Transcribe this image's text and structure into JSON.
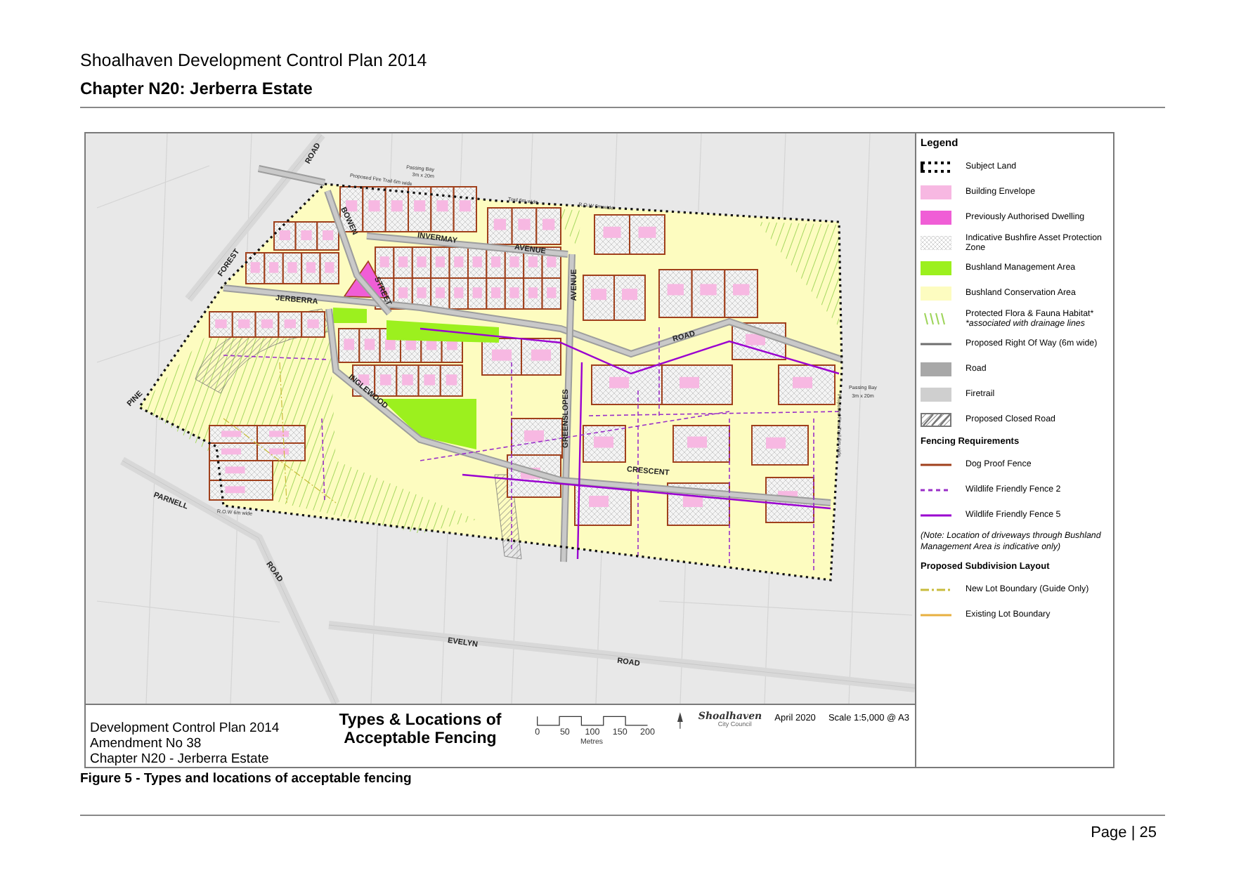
{
  "header": {
    "title": "Shoalhaven Development Control Plan 2014",
    "chapter": "Chapter N20: Jerberra Estate"
  },
  "map_labels": [
    {
      "text": "ROAD",
      "kind": "street"
    },
    {
      "text": "FOREST",
      "kind": "street"
    },
    {
      "text": "PINE",
      "kind": "street"
    },
    {
      "text": "BOWEN",
      "kind": "street"
    },
    {
      "text": "STREET",
      "kind": "street"
    },
    {
      "text": "INVERMAY",
      "kind": "street"
    },
    {
      "text": "AVENUE",
      "kind": "street"
    },
    {
      "text": "JERBERRA",
      "kind": "street"
    },
    {
      "text": "AVENUE",
      "kind": "street"
    },
    {
      "text": "ROAD",
      "kind": "street"
    },
    {
      "text": "GREENSLOPES",
      "kind": "street"
    },
    {
      "text": "INGLEWOOD",
      "kind": "street"
    },
    {
      "text": "CRESCENT",
      "kind": "street"
    },
    {
      "text": "PARNELL",
      "kind": "street"
    },
    {
      "text": "ROAD",
      "kind": "street"
    },
    {
      "text": "EVELYN",
      "kind": "street"
    },
    {
      "text": "ROAD",
      "kind": "street"
    },
    {
      "text": "Proposed Fire Trail 6m wide",
      "kind": "note"
    },
    {
      "text": "Passing Bay",
      "kind": "note"
    },
    {
      "text": "3m x 20m",
      "kind": "note"
    },
    {
      "text": "Trail 6m wide",
      "kind": "note"
    },
    {
      "text": "R.O.W 6m wide",
      "kind": "note"
    },
    {
      "text": "Passing Bay",
      "kind": "note"
    },
    {
      "text": "3m x 20m",
      "kind": "note"
    },
    {
      "text": "Proposed Fire Trail 6m wide",
      "kind": "note"
    },
    {
      "text": "R.O.W 6m wide",
      "kind": "note"
    }
  ],
  "info": {
    "lines": [
      "Development Control Plan 2014",
      "Amendment  No 38",
      "Chapter N20 - Jerberra Estate"
    ],
    "title": [
      "Types & Locations of",
      "Acceptable Fencing"
    ],
    "scale_ticks": [
      "0",
      "50",
      "100",
      "150",
      "200"
    ],
    "scale_unit": "Metres",
    "logo": {
      "name": "Shoalhaven",
      "subtitle": "City Council"
    },
    "date": "April 2020",
    "scale": "Scale 1:5,000 @ A3"
  },
  "legend": [
    {
      "heading": "Legend",
      "items": [
        {
          "label": "Subject Land",
          "kind": "dots",
          "color": "#000000"
        },
        {
          "label": "Building Envelope",
          "kind": "fill",
          "color": "#f7b8e2"
        },
        {
          "label": "Previously Authorised Dwelling",
          "kind": "fill",
          "color": "#f05ed6"
        },
        {
          "label": "Indicative Bushfire Asset Protection Zone",
          "kind": "crosshatch",
          "color": "#c8c8c8"
        },
        {
          "label": "Bushland Management Area",
          "kind": "fill",
          "color": "#9cf01e"
        },
        {
          "label": "Bushland Conservation Area",
          "kind": "fill",
          "color": "#fdfcc0"
        },
        {
          "label": "Protected Flora & Fauna Habitat*",
          "note": "*associated with drainage lines",
          "kind": "stripes",
          "color": "#9ed45a"
        },
        {
          "label": "Proposed Right Of Way (6m wide)",
          "kind": "line",
          "color": "#6e6e6e"
        },
        {
          "label": "Road",
          "kind": "fill",
          "color": "#a8a8a8"
        },
        {
          "label": "Firetrail",
          "kind": "fill",
          "color": "#cfcfcf"
        },
        {
          "label": "Proposed Closed Road",
          "kind": "hatch",
          "color": "#777777"
        }
      ]
    },
    {
      "heading": "Fencing Requirements",
      "items": [
        {
          "label": "Dog Proof Fence",
          "kind": "line",
          "color": "#a0401c"
        },
        {
          "label": "Wildlife Friendly Fence 2",
          "kind": "dash",
          "color": "#9a30c8"
        },
        {
          "label": "Wildlife Friendly Fence 5",
          "kind": "line",
          "color": "#9a00d0"
        }
      ],
      "note": "(Note: Location of driveways through Bushland Management Area is indicative only)"
    },
    {
      "heading": "Proposed Subdivision Layout",
      "items": [
        {
          "label": "New Lot Boundary (Guide Only)",
          "kind": "dashdot",
          "color": "#c8bc3c"
        },
        {
          "label": "Existing Lot Boundary",
          "kind": "line",
          "color": "#e8b040"
        }
      ]
    }
  ],
  "caption": "Figure 5 - Types and locations of acceptable fencing",
  "footer": {
    "page": "Page | 25"
  }
}
